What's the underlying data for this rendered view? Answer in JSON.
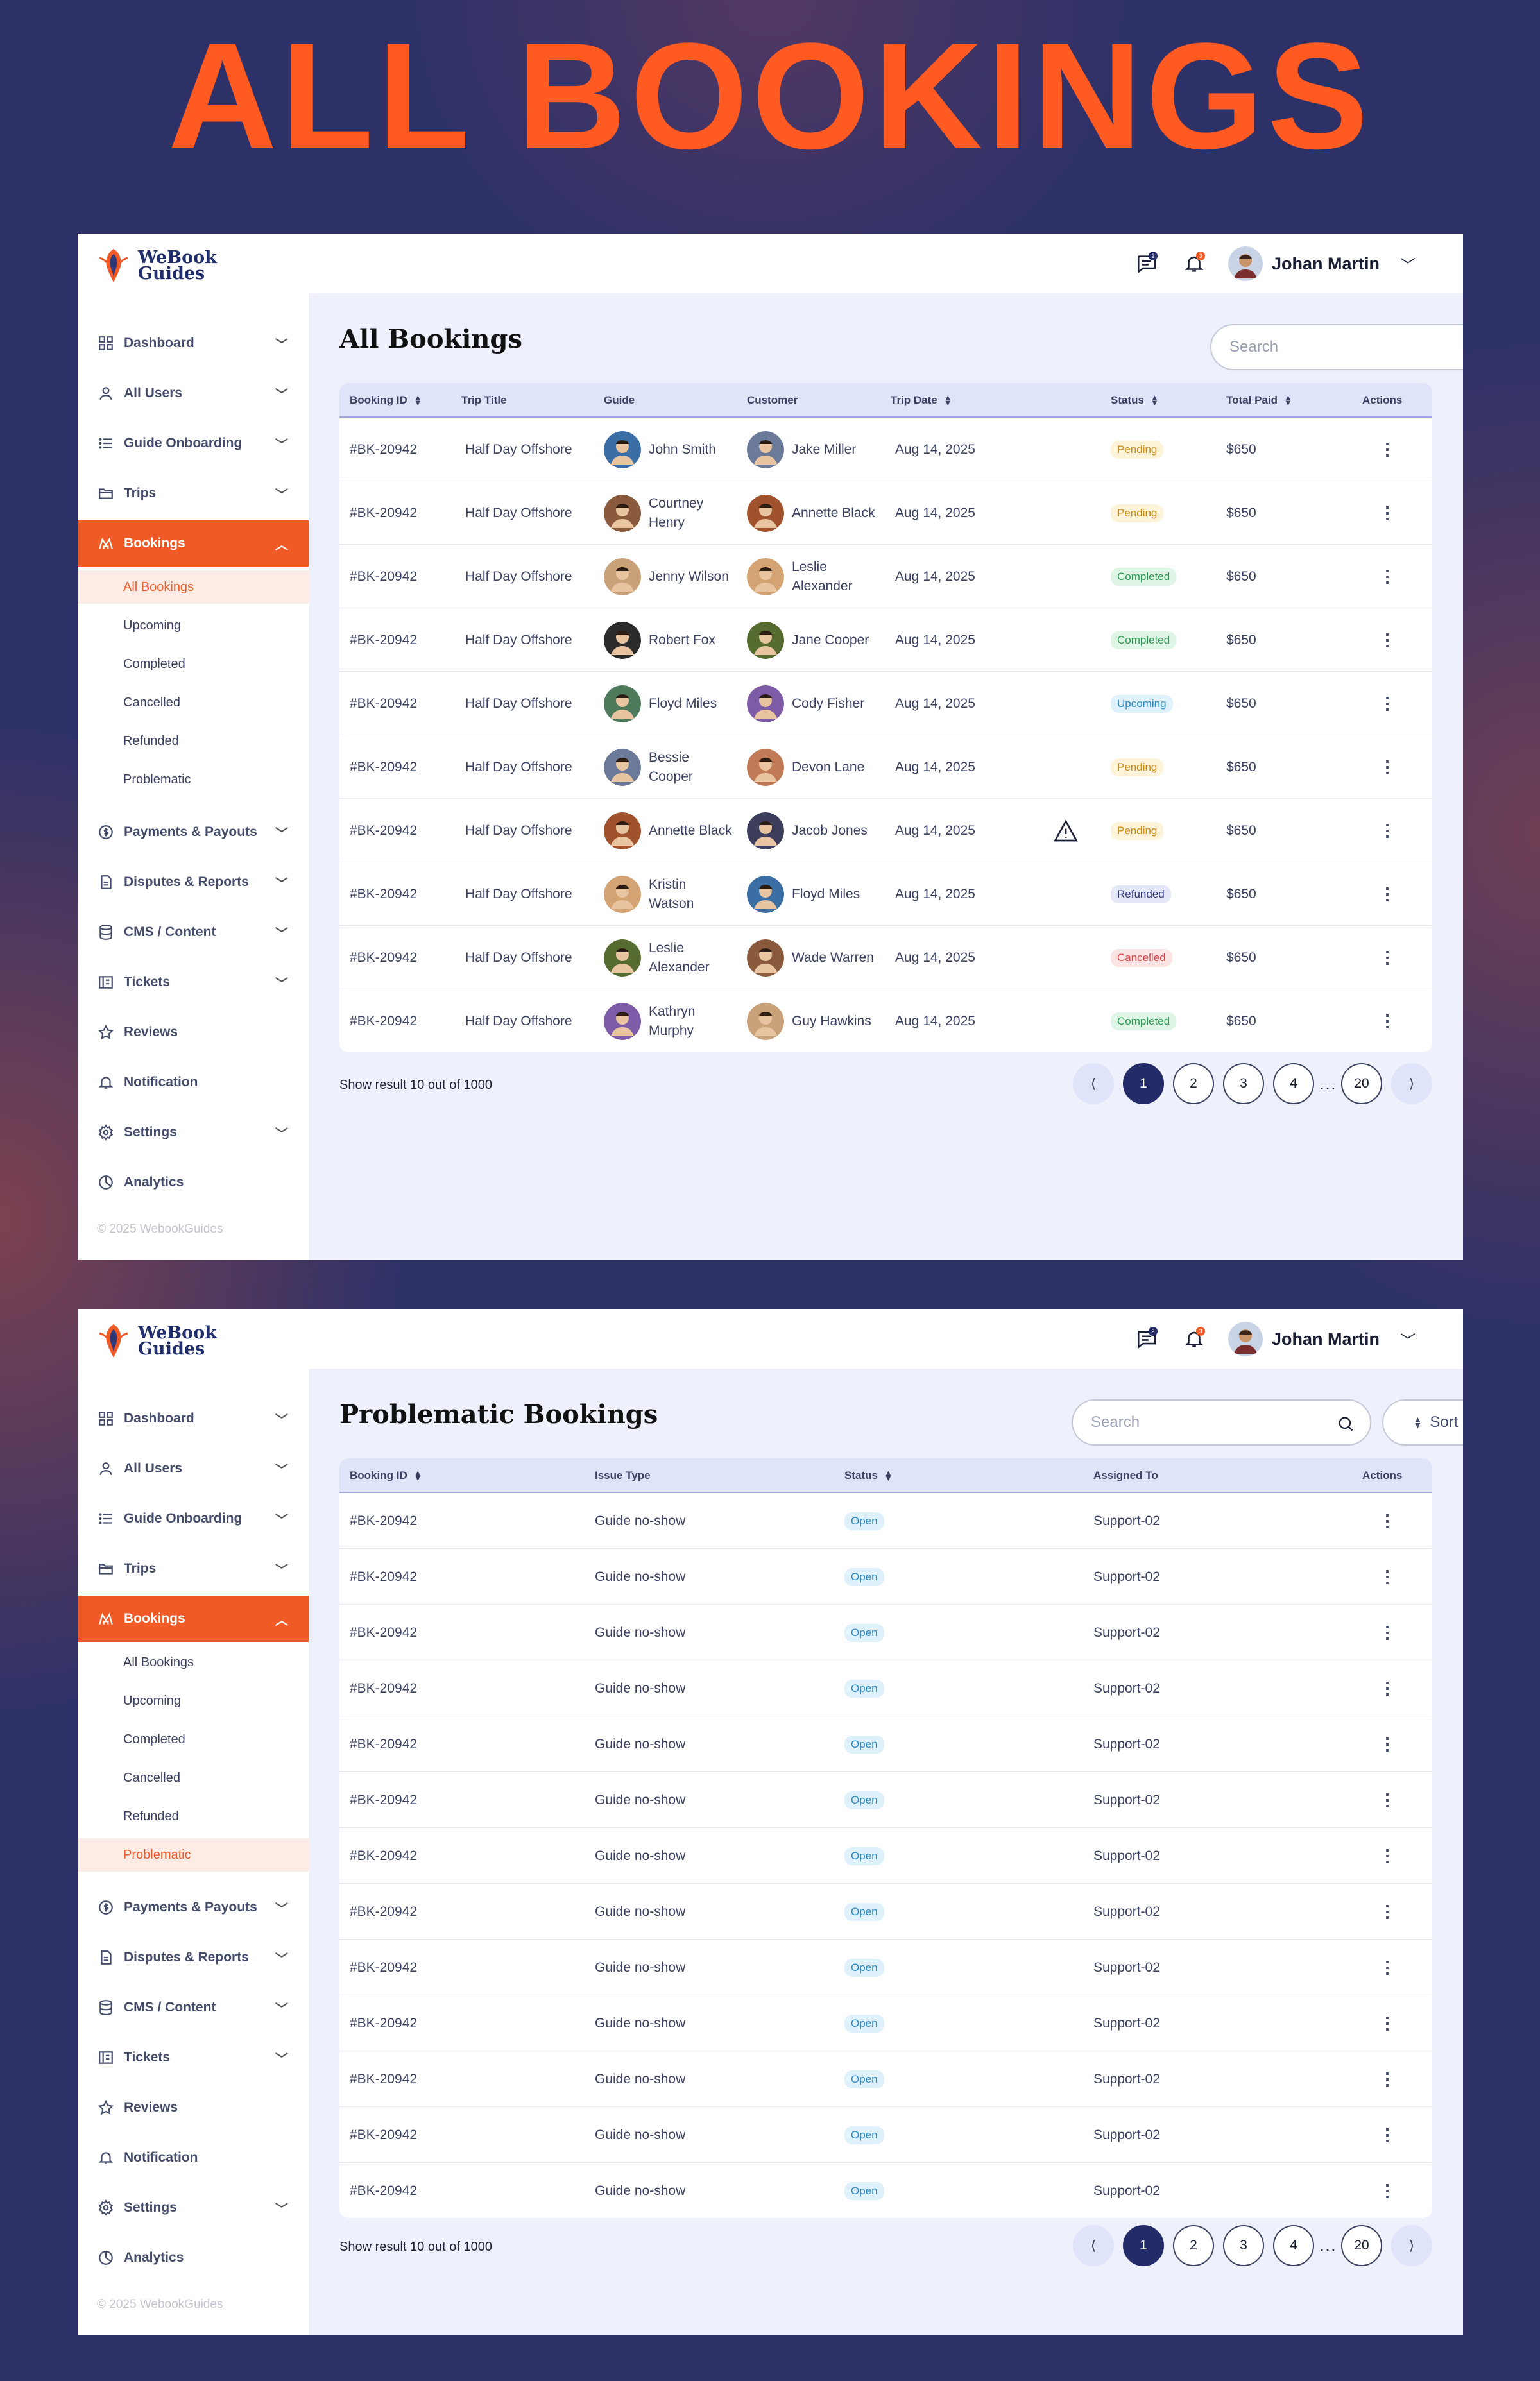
{
  "hero_title": "ALL BOOKINGS",
  "brand": {
    "line1": "WeBook",
    "line2": "Guides"
  },
  "topbar": {
    "user_name": "Johan Martin",
    "messages_badge": "2",
    "notifications_badge": "3"
  },
  "sidebar": {
    "items": [
      {
        "label": "Dashboard",
        "icon": "grid-icon",
        "chevron": true
      },
      {
        "label": "All Users",
        "icon": "user-icon",
        "chevron": true
      },
      {
        "label": "Guide Onboarding",
        "icon": "list-icon",
        "chevron": true
      },
      {
        "label": "Trips",
        "icon": "folder-icon",
        "chevron": true
      },
      {
        "label": "Bookings",
        "icon": "bookings-icon",
        "chevron": true,
        "active": true
      },
      {
        "label": "Payments & Payouts",
        "icon": "dollar-icon",
        "chevron": true
      },
      {
        "label": "Disputes & Reports",
        "icon": "document-icon",
        "chevron": true
      },
      {
        "label": "CMS / Content",
        "icon": "database-icon",
        "chevron": true
      },
      {
        "label": "Tickets",
        "icon": "ticket-icon",
        "chevron": true
      },
      {
        "label": "Reviews",
        "icon": "star-icon",
        "chevron": false
      },
      {
        "label": "Notification",
        "icon": "bell-icon",
        "chevron": false
      },
      {
        "label": "Settings",
        "icon": "gear-icon",
        "chevron": true
      },
      {
        "label": "Analytics",
        "icon": "pie-icon",
        "chevron": false
      }
    ],
    "sub_items": [
      "All Bookings",
      "Upcoming",
      "Completed",
      "Cancelled",
      "Refunded",
      "Problematic"
    ],
    "copyright": "© 2025 WebookGuides"
  },
  "all_bookings": {
    "title": "All Bookings",
    "search_placeholder": "Search",
    "columns": [
      "Booking ID",
      "Trip Title",
      "Guide",
      "Customer",
      "Trip Date",
      "Status",
      "Total Paid",
      "Actions"
    ],
    "rows": [
      {
        "id": "#BK-20942",
        "trip": "Half Day Offshore",
        "guide": "John Smith",
        "customer": "Jake Miller",
        "date": "Aug 14, 2025",
        "status": "Pending",
        "paid": "$650",
        "warn": false
      },
      {
        "id": "#BK-20942",
        "trip": "Half Day Offshore",
        "guide": "Courtney Henry",
        "customer": "Annette Black",
        "date": "Aug 14, 2025",
        "status": "Pending",
        "paid": "$650",
        "warn": false
      },
      {
        "id": "#BK-20942",
        "trip": "Half Day Offshore",
        "guide": "Jenny Wilson",
        "customer": "Leslie Alexander",
        "date": "Aug 14, 2025",
        "status": "Completed",
        "paid": "$650",
        "warn": false
      },
      {
        "id": "#BK-20942",
        "trip": "Half Day Offshore",
        "guide": "Robert Fox",
        "customer": "Jane Cooper",
        "date": "Aug 14, 2025",
        "status": "Completed",
        "paid": "$650",
        "warn": false
      },
      {
        "id": "#BK-20942",
        "trip": "Half Day Offshore",
        "guide": "Floyd Miles",
        "customer": "Cody Fisher",
        "date": "Aug 14, 2025",
        "status": "Upcoming",
        "paid": "$650",
        "warn": false
      },
      {
        "id": "#BK-20942",
        "trip": "Half Day Offshore",
        "guide": "Bessie Cooper",
        "customer": "Devon Lane",
        "date": "Aug 14, 2025",
        "status": "Pending",
        "paid": "$650",
        "warn": false
      },
      {
        "id": "#BK-20942",
        "trip": "Half Day Offshore",
        "guide": "Annette Black",
        "customer": "Jacob Jones",
        "date": "Aug 14, 2025",
        "status": "Pending",
        "paid": "$650",
        "warn": true
      },
      {
        "id": "#BK-20942",
        "trip": "Half Day Offshore",
        "guide": "Kristin Watson",
        "customer": "Floyd Miles",
        "date": "Aug 14, 2025",
        "status": "Refunded",
        "paid": "$650",
        "warn": false
      },
      {
        "id": "#BK-20942",
        "trip": "Half Day Offshore",
        "guide": "Leslie Alexander",
        "customer": "Wade Warren",
        "date": "Aug 14, 2025",
        "status": "Cancelled",
        "paid": "$650",
        "warn": false
      },
      {
        "id": "#BK-20942",
        "trip": "Half Day Offshore",
        "guide": "Kathryn Murphy",
        "customer": "Guy Hawkins",
        "date": "Aug 14, 2025",
        "status": "Completed",
        "paid": "$650",
        "warn": false
      }
    ],
    "result_text": "Show result 10 out of 1000"
  },
  "problematic": {
    "title": "Problematic Bookings",
    "search_placeholder": "Search",
    "sort_label": "Sort by",
    "columns": [
      "Booking ID",
      "Issue Type",
      "Status",
      "Assigned To",
      "Actions"
    ],
    "rows": [
      {
        "id": "#BK-20942",
        "issue": "Guide no-show",
        "status": "Open",
        "assigned": "Support-02"
      },
      {
        "id": "#BK-20942",
        "issue": "Guide no-show",
        "status": "Open",
        "assigned": "Support-02"
      },
      {
        "id": "#BK-20942",
        "issue": "Guide no-show",
        "status": "Open",
        "assigned": "Support-02"
      },
      {
        "id": "#BK-20942",
        "issue": "Guide no-show",
        "status": "Open",
        "assigned": "Support-02"
      },
      {
        "id": "#BK-20942",
        "issue": "Guide no-show",
        "status": "Open",
        "assigned": "Support-02"
      },
      {
        "id": "#BK-20942",
        "issue": "Guide no-show",
        "status": "Open",
        "assigned": "Support-02"
      },
      {
        "id": "#BK-20942",
        "issue": "Guide no-show",
        "status": "Open",
        "assigned": "Support-02"
      },
      {
        "id": "#BK-20942",
        "issue": "Guide no-show",
        "status": "Open",
        "assigned": "Support-02"
      },
      {
        "id": "#BK-20942",
        "issue": "Guide no-show",
        "status": "Open",
        "assigned": "Support-02"
      },
      {
        "id": "#BK-20942",
        "issue": "Guide no-show",
        "status": "Open",
        "assigned": "Support-02"
      },
      {
        "id": "#BK-20942",
        "issue": "Guide no-show",
        "status": "Open",
        "assigned": "Support-02"
      },
      {
        "id": "#BK-20942",
        "issue": "Guide no-show",
        "status": "Open",
        "assigned": "Support-02"
      },
      {
        "id": "#BK-20942",
        "issue": "Guide no-show",
        "status": "Open",
        "assigned": "Support-02"
      }
    ],
    "result_text": "Show result 10 out of 1000"
  },
  "pagination": {
    "prev": "⟨",
    "next": "⟩",
    "pages": [
      "1",
      "2",
      "3",
      "4"
    ],
    "ellipsis": "…",
    "last": "20",
    "current": "1"
  },
  "colors": {
    "accent": "#f05a27",
    "navy": "#232b68",
    "hero": "#ff5a22"
  }
}
